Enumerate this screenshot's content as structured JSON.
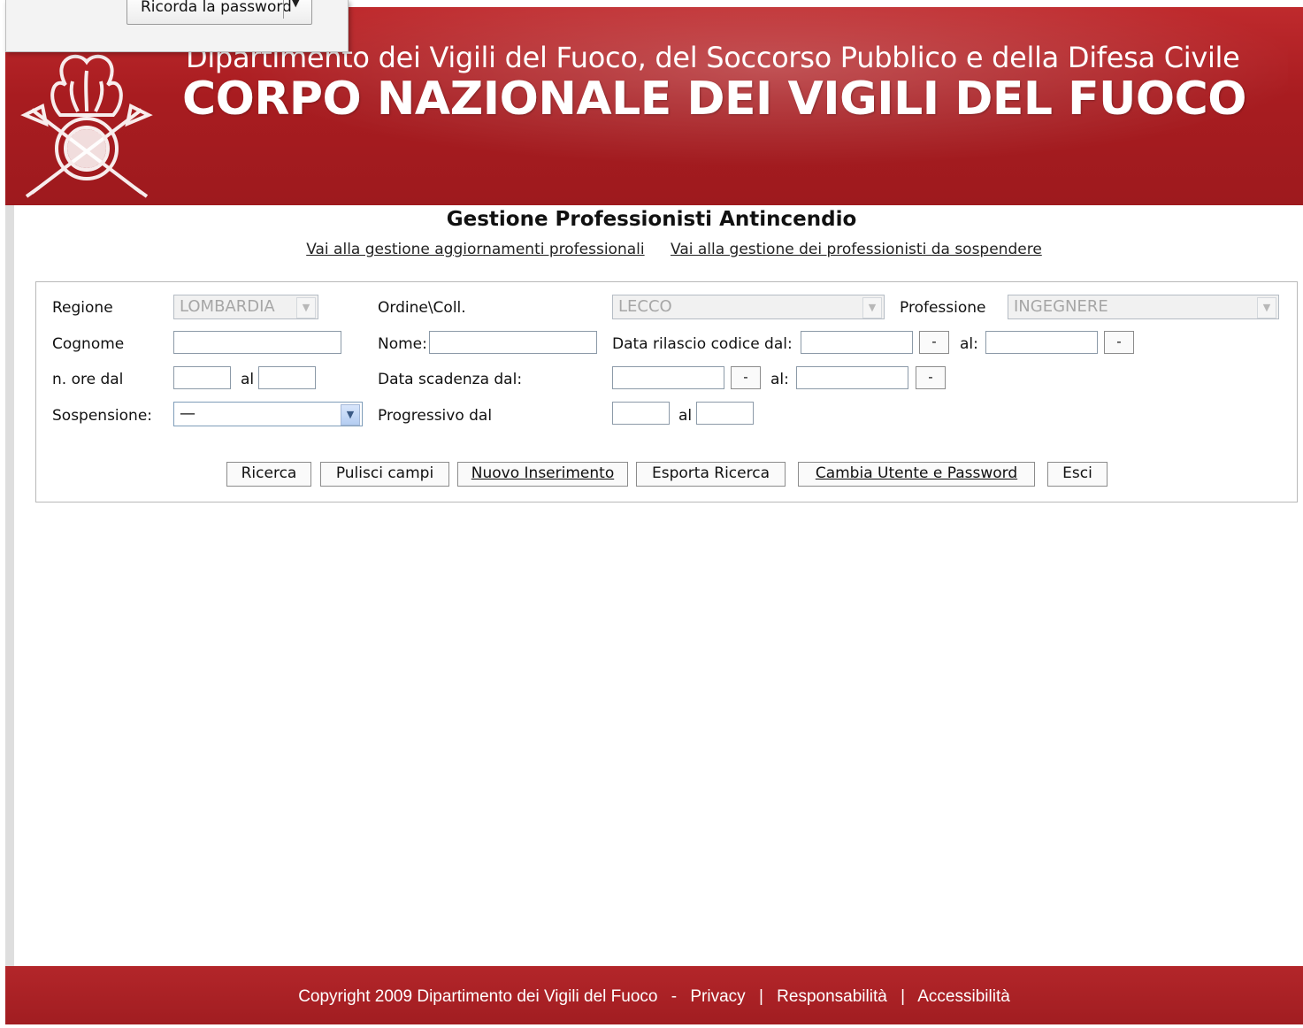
{
  "browser_popup": {
    "button_label": "Ricorda la password"
  },
  "header": {
    "subtitle": "Dipartimento dei Vigili del Fuoco, del Soccorso Pubblico e della Difesa Civile",
    "title": "CORPO NAZIONALE DEI VIGILI DEL FUOCO",
    "colors": {
      "banner": "#a81c20",
      "text": "#ffffff"
    }
  },
  "page": {
    "title": "Gestione Professionisti Antincendio",
    "links": [
      "Vai alla gestione aggiornamenti professionali",
      "Vai alla gestione dei professionisti da sospendere"
    ]
  },
  "form": {
    "regione": {
      "label": "Regione",
      "value": "LOMBARDIA"
    },
    "ordine": {
      "label": "Ordine\\Coll.",
      "value": "LECCO"
    },
    "professione": {
      "label": "Professione",
      "value": "INGEGNERE"
    },
    "cognome": {
      "label": "Cognome",
      "value": ""
    },
    "nome": {
      "label": "Nome:",
      "value": ""
    },
    "data_rilascio": {
      "label": "Data rilascio codice dal:",
      "al_label": "al:",
      "btn": "-"
    },
    "ore": {
      "label": "n. ore dal",
      "al_label": "al"
    },
    "data_scadenza": {
      "label": "Data scadenza dal:",
      "al_label": "al:",
      "btn": "-"
    },
    "sospensione": {
      "label": "Sospensione:",
      "value": "—"
    },
    "progressivo": {
      "label": "Progressivo dal",
      "al_label": "al"
    }
  },
  "buttons": {
    "ricerca": "Ricerca",
    "pulisci": "Pulisci campi",
    "nuovo": "Nuovo Inserimento",
    "esporta": "Esporta Ricerca",
    "cambia": "Cambia Utente e Password",
    "esci": "Esci"
  },
  "footer": {
    "copyright": "Copyright 2009 Dipartimento dei Vigili del Fuoco",
    "dash": "-",
    "pipe": "|",
    "links": [
      "Privacy",
      "Responsabilità",
      "Accessibilità"
    ]
  }
}
